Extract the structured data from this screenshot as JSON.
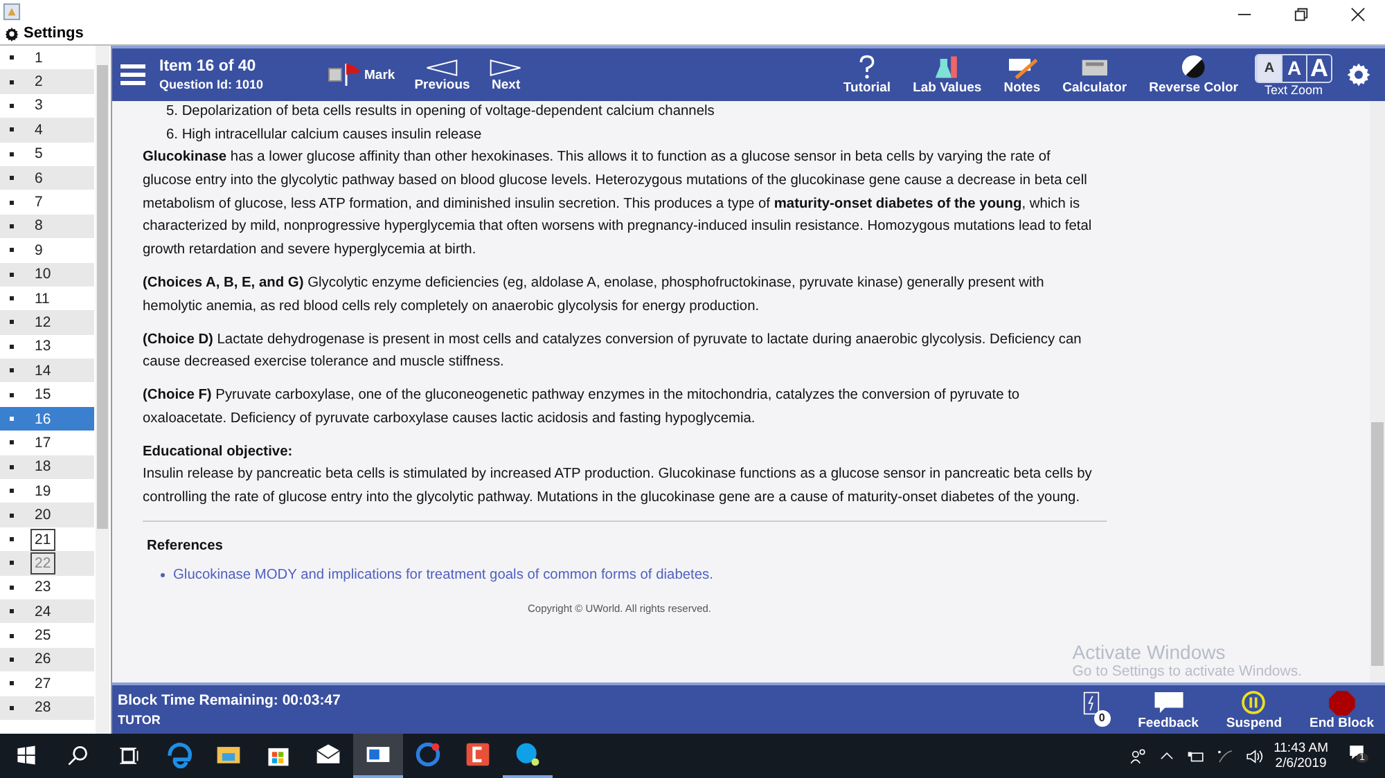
{
  "settings_label": "Settings",
  "sidebar": {
    "items": [
      {
        "label": "1",
        "selected": false,
        "boxed": false,
        "greyed": false
      },
      {
        "label": "2",
        "selected": false,
        "boxed": false,
        "greyed": false
      },
      {
        "label": "3",
        "selected": false,
        "boxed": false,
        "greyed": false
      },
      {
        "label": "4",
        "selected": false,
        "boxed": false,
        "greyed": false
      },
      {
        "label": "5",
        "selected": false,
        "boxed": false,
        "greyed": false
      },
      {
        "label": "6",
        "selected": false,
        "boxed": false,
        "greyed": false
      },
      {
        "label": "7",
        "selected": false,
        "boxed": false,
        "greyed": false
      },
      {
        "label": "8",
        "selected": false,
        "boxed": false,
        "greyed": false
      },
      {
        "label": "9",
        "selected": false,
        "boxed": false,
        "greyed": false
      },
      {
        "label": "10",
        "selected": false,
        "boxed": false,
        "greyed": false
      },
      {
        "label": "11",
        "selected": false,
        "boxed": false,
        "greyed": false
      },
      {
        "label": "12",
        "selected": false,
        "boxed": false,
        "greyed": false
      },
      {
        "label": "13",
        "selected": false,
        "boxed": false,
        "greyed": false
      },
      {
        "label": "14",
        "selected": false,
        "boxed": false,
        "greyed": false
      },
      {
        "label": "15",
        "selected": false,
        "boxed": false,
        "greyed": false
      },
      {
        "label": "16",
        "selected": true,
        "boxed": false,
        "greyed": false
      },
      {
        "label": "17",
        "selected": false,
        "boxed": false,
        "greyed": false
      },
      {
        "label": "18",
        "selected": false,
        "boxed": false,
        "greyed": false
      },
      {
        "label": "19",
        "selected": false,
        "boxed": false,
        "greyed": false
      },
      {
        "label": "20",
        "selected": false,
        "boxed": false,
        "greyed": false
      },
      {
        "label": "21",
        "selected": false,
        "boxed": true,
        "greyed": false
      },
      {
        "label": "22",
        "selected": false,
        "boxed": true,
        "greyed": true
      },
      {
        "label": "23",
        "selected": false,
        "boxed": false,
        "greyed": false
      },
      {
        "label": "24",
        "selected": false,
        "boxed": false,
        "greyed": false
      },
      {
        "label": "25",
        "selected": false,
        "boxed": false,
        "greyed": false
      },
      {
        "label": "26",
        "selected": false,
        "boxed": false,
        "greyed": false
      },
      {
        "label": "27",
        "selected": false,
        "boxed": false,
        "greyed": false
      },
      {
        "label": "28",
        "selected": false,
        "boxed": false,
        "greyed": false
      }
    ]
  },
  "header": {
    "item": "Item 16 of 40",
    "question_id": "Question Id: 1010",
    "mark": {
      "label": "Mark",
      "checked": false
    },
    "nav": [
      {
        "kind": "previous",
        "label": "Previous"
      },
      {
        "kind": "next",
        "label": "Next"
      }
    ],
    "tools": [
      {
        "kind": "tutorial",
        "label": "Tutorial"
      },
      {
        "kind": "lab",
        "label": "Lab Values"
      },
      {
        "kind": "notes",
        "label": "Notes"
      },
      {
        "kind": "calculator",
        "label": "Calculator"
      },
      {
        "kind": "reverse",
        "label": "Reverse Color"
      }
    ],
    "text_zoom": {
      "label": "Text Zoom",
      "levels": [
        {
          "label": "A",
          "selected": true
        },
        {
          "label": "A",
          "selected": false
        },
        {
          "label": "A",
          "selected": false
        }
      ]
    }
  },
  "content": {
    "steps": [
      "5. Depolarization of beta cells results in opening of voltage-dependent calcium channels",
      "6. High intracellular calcium causes insulin release"
    ],
    "paragraphs": [
      "**Glucokinase** has a lower glucose affinity than other hexokinases.  This allows it to function as a glucose sensor in beta cells by varying the rate of glucose entry into the glycolytic pathway based on blood glucose levels.  Heterozygous mutations of the glucokinase gene cause a decrease in beta cell metabolism of glucose, less ATP formation, and diminished insulin secretion.  This produces a type of **maturity-onset diabetes of the young**, which is characterized by mild, nonprogressive hyperglycemia that often worsens with pregnancy-induced insulin resistance.  Homozygous mutations lead to fetal growth retardation and severe hyperglycemia at birth.",
      "**(Choices A, B, E, and G)**  Glycolytic enzyme deficiencies (eg, aldolase A, enolase, phosphofructokinase, pyruvate kinase) generally present with hemolytic anemia, as red blood cells rely completely on anaerobic glycolysis for energy production.",
      "**(Choice D)**  Lactate dehydrogenase is present in most cells and catalyzes conversion of pyruvate to lactate during anaerobic glycolysis.  Deficiency can cause decreased exercise tolerance and muscle stiffness.",
      "**(Choice F)**  Pyruvate carboxylase, one of the gluconeogenetic pathway enzymes in the mitochondria, catalyzes the conversion of pyruvate to oxaloacetate.  Deficiency of pyruvate carboxylase causes lactic acidosis and fasting hypoglycemia."
    ],
    "objective": {
      "title": "Educational objective:",
      "text": "Insulin release by pancreatic beta cells is stimulated by increased ATP production.  Glucokinase functions as a glucose sensor in pancreatic beta cells by controlling the rate of glucose entry into the glycolytic pathway.  Mutations in the glucokinase gene are a cause of maturity-onset diabetes of the young."
    },
    "references": {
      "title": "References",
      "links": [
        "Glucokinase MODY and implications for treatment goals of common forms of diabetes."
      ]
    },
    "copyright": "Copyright © UWorld. All rights reserved."
  },
  "activation": {
    "title": "Activate Windows",
    "text": "Go to Settings to activate Windows."
  },
  "footer": {
    "time": "Block Time Remaining: 00:03:47",
    "mode": "TUTOR",
    "badge": "0",
    "actions": [
      {
        "kind": "feedback",
        "label": "Feedback"
      },
      {
        "kind": "suspend",
        "label": "Suspend"
      },
      {
        "kind": "end",
        "label": "End Block"
      }
    ]
  },
  "taskbar": {
    "apps": [
      {
        "kind": "edge",
        "selected": false,
        "running": false
      },
      {
        "kind": "folder",
        "selected": false,
        "running": false
      },
      {
        "kind": "store",
        "selected": false,
        "running": false
      },
      {
        "kind": "mail",
        "selected": false,
        "running": false
      },
      {
        "kind": "window",
        "selected": true,
        "running": true
      },
      {
        "kind": "chrome",
        "selected": false,
        "running": false
      },
      {
        "kind": "red",
        "selected": false,
        "running": false
      },
      {
        "kind": "skype",
        "selected": false,
        "running": true
      }
    ],
    "time": "11:43 AM",
    "date": "2/6/2019",
    "notifications": "1"
  }
}
